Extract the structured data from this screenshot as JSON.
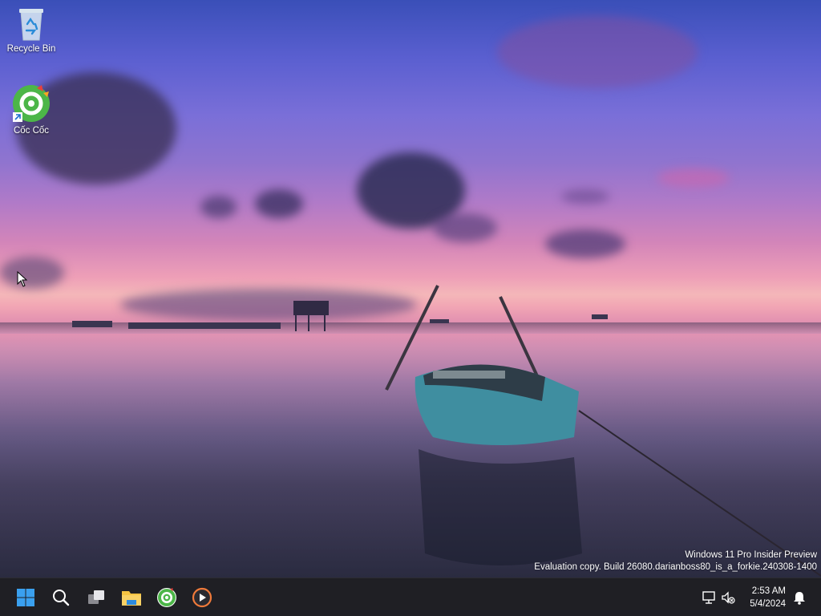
{
  "desktop": {
    "icons": [
      {
        "label": "Recycle Bin",
        "icon": "recycle-bin-icon"
      },
      {
        "label": "Cốc Cốc",
        "icon": "coccoc-browser-icon"
      }
    ],
    "watermark": {
      "line1": "Windows 11 Pro Insider Preview",
      "line2": "Evaluation copy. Build 26080.darianboss80_is_a_forkie.240308-1400"
    }
  },
  "taskbar": {
    "items": [
      {
        "name": "start",
        "icon": "windows-start-icon"
      },
      {
        "name": "search",
        "icon": "search-icon"
      },
      {
        "name": "task-view",
        "icon": "task-view-icon"
      },
      {
        "name": "file-explorer",
        "icon": "folder-icon"
      },
      {
        "name": "coccoc",
        "icon": "coccoc-browser-icon"
      },
      {
        "name": "media-player",
        "icon": "media-player-icon"
      }
    ],
    "tray": {
      "network_icon": "network-icon",
      "volume_icon": "volume-muted-icon",
      "time": "2:53 AM",
      "date": "5/4/2024",
      "notification_icon": "bell-icon"
    }
  },
  "colors": {
    "taskbar_bg": "#1f1f24",
    "start_blue": "#3aa0ef",
    "folder_yellow": "#f5c342",
    "coccoc_green": "#4cb648"
  }
}
